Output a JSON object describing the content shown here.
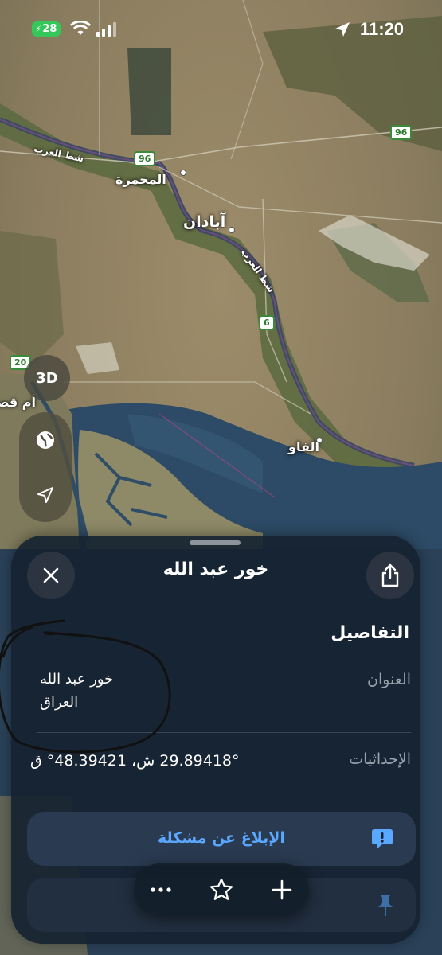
{
  "status_bar": {
    "battery": "28",
    "time": "11:20"
  },
  "map": {
    "labels": {
      "shatt_al_arab_1": "شط العرب",
      "shatt_al_arab_2": "شط العرب",
      "mohammerah": "المحمرة",
      "abadan": "آبادان",
      "fao": "الفاو",
      "umm_qasr": "أم قصر"
    },
    "road_shields": {
      "r96_a": "96",
      "r96_b": "96",
      "r6": "6",
      "r20": "20"
    }
  },
  "controls": {
    "three_d": "3D"
  },
  "sheet": {
    "title": "خور عبد الله",
    "details_heading": "التفاصيل",
    "address_label": "العنوان",
    "address_line1": "خور عبد الله",
    "address_line2": "العراق",
    "coords_label": "الإحداثيات",
    "coords_value": "29.89418° ش، 48.39421° ق",
    "report_label": "الإبلاغ عن مشكلة"
  },
  "colors": {
    "accent": "#5aa8ff",
    "battery": "#34c759",
    "road": "#3a8a3a"
  }
}
